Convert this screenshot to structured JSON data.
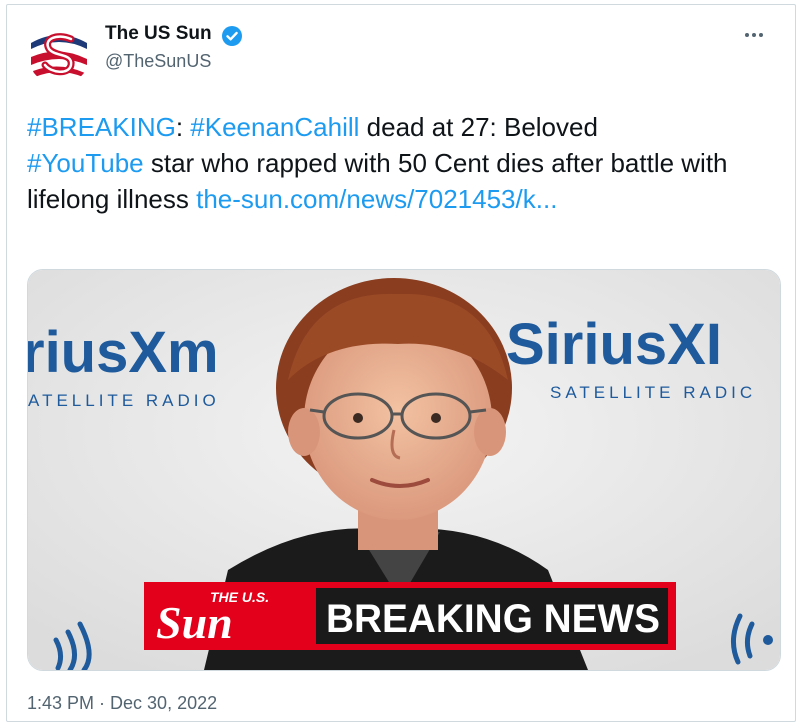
{
  "author": {
    "name": "The US Sun",
    "handle": "@TheSunUS"
  },
  "tweet": {
    "segments": [
      {
        "text": "#BREAKING",
        "type": "hashtag"
      },
      {
        "text": ": ",
        "type": "text"
      },
      {
        "text": "#KeenanCahill",
        "type": "hashtag"
      },
      {
        "text": " dead at 27: Beloved ",
        "type": "text"
      },
      {
        "text": "#YouTube",
        "type": "hashtag"
      },
      {
        "text": " star who rapped with 50 Cent dies after battle with lifelong illness ",
        "type": "text"
      },
      {
        "text": "the-sun.com/news/7021453/k...",
        "type": "link"
      }
    ]
  },
  "media": {
    "backdrop_left": "riusXm",
    "backdrop_left_sub": "ATELLITE RADIO",
    "backdrop_right": "SiriusXI",
    "backdrop_right_sub": "SATELLITE RADIC",
    "banner_brand_top": "THE U.S.",
    "banner_brand": "Sun",
    "banner_text": "BREAKING NEWS"
  },
  "meta": {
    "timestamp": "1:43 PM · Dec 30, 2022"
  },
  "colors": {
    "link": "#1d9bf0",
    "verified": "#1d9bf0",
    "banner_red": "#e2001a",
    "banner_dark": "#1a1a1a"
  }
}
